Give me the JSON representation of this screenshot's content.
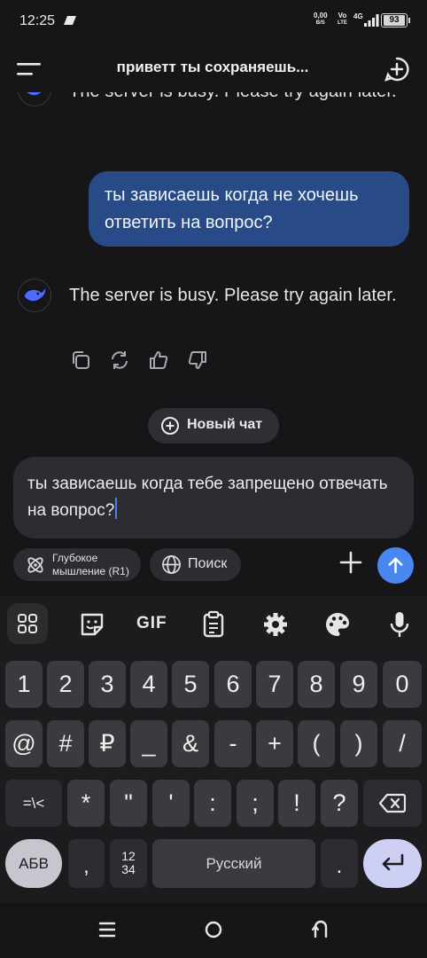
{
  "status_bar": {
    "time": "12:25",
    "net_speed_value": "0,00",
    "net_speed_unit": "B/S",
    "volte_top": "Vo",
    "volte_bottom": "LTE",
    "network": "4G",
    "battery": "93"
  },
  "header": {
    "title": "приветт ты сохраняешь..."
  },
  "chat": {
    "messages": [
      {
        "role": "assistant",
        "text": "The server is busy. Please try again later."
      },
      {
        "role": "user",
        "text": "ты зависаешь когда не хочешь ответить на вопрос?"
      },
      {
        "role": "assistant",
        "text": "The server is busy. Please try again later."
      }
    ],
    "message_action_icons": [
      "copy-icon",
      "regenerate-icon",
      "thumbs-up-icon",
      "thumbs-down-icon"
    ],
    "new_chat_label": "Новый чат"
  },
  "composer": {
    "input_value": "ты зависаешь когда тебе запрещено отвечать на вопрос?",
    "deep_think_label": "Глубокое мышление (R1)",
    "search_label": "Поиск"
  },
  "keyboard": {
    "toolbar": [
      "apps-grid-icon",
      "sticker-icon",
      "gif-icon",
      "clipboard-icon",
      "settings-gear-icon",
      "theme-palette-icon",
      "microphone-icon"
    ],
    "gif_label": "GIF",
    "row1": [
      "1",
      "2",
      "3",
      "4",
      "5",
      "6",
      "7",
      "8",
      "9",
      "0"
    ],
    "row2": [
      "@",
      "#",
      "₽",
      "_",
      "&",
      "-",
      "+",
      "(",
      ")",
      "/"
    ],
    "row3": [
      "=\\<",
      "*",
      "\"",
      "'",
      ":",
      ";",
      "!",
      "?"
    ],
    "abc_label": "АБВ",
    "comma": ",",
    "numpad_label_top": "12",
    "numpad_label_bottom": "34",
    "space_label": "Русский",
    "period": "."
  },
  "colors": {
    "background": "#161618",
    "user_bubble": "#284b87",
    "accent": "#4a86f0",
    "key": "#3b3b3f"
  }
}
